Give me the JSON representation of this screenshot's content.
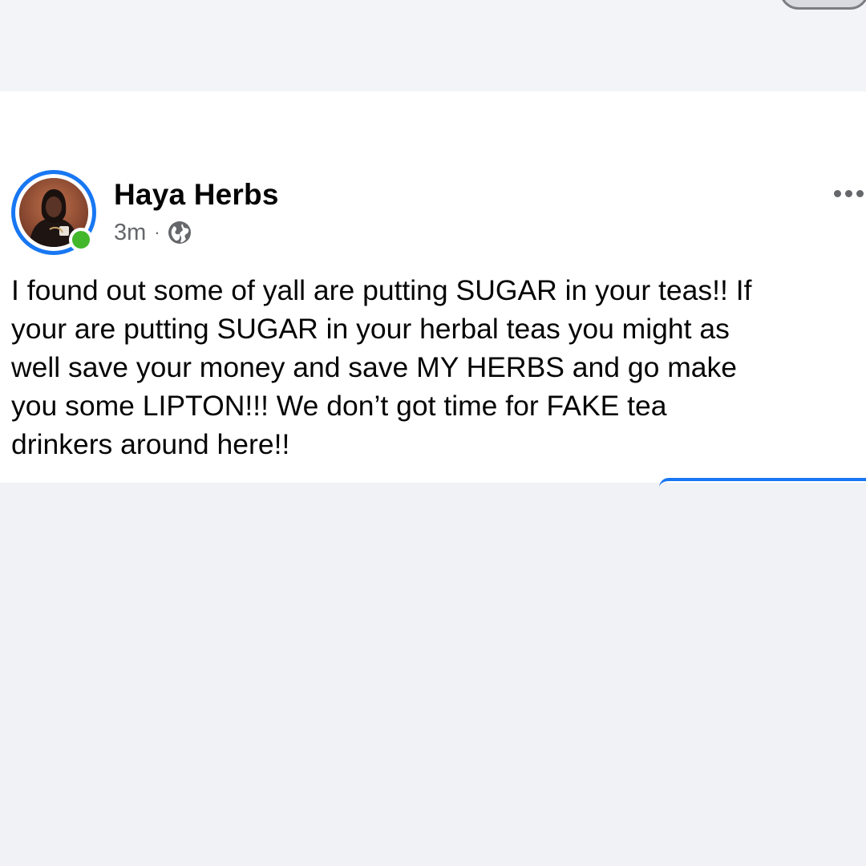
{
  "post": {
    "author": "Haya Herbs",
    "time": "3m",
    "separator": "·",
    "privacy_icon": "globe-icon",
    "text": "I found out some of yall are putting SUGAR in your teas!! If\nyour are putting SUGAR in your herbal teas you might as\nwell save your money and save MY HERBS and go make\nyou some LIPTON!!! We don’t got time for FAKE tea\ndrinkers around here!!"
  },
  "colors": {
    "story_ring": "#1877f2",
    "online_status": "#42b72a",
    "feed_background": "#f0f2f5",
    "meta_text": "#65676b"
  }
}
